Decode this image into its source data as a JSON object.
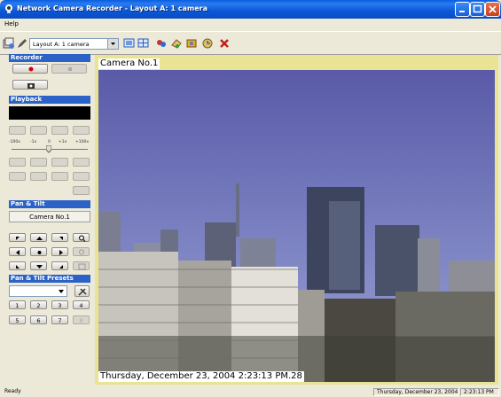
{
  "window": {
    "title": "Network Camera Recorder - Layout A: 1 camera"
  },
  "menu": {
    "help": "Help"
  },
  "toolbar": {
    "layout_select": "Layout A: 1 camera"
  },
  "sections": {
    "recorder": "Recorder",
    "playback": "Playback",
    "pan_tilt": "Pan & Tilt",
    "presets": "Pan & Tilt Presets"
  },
  "playback": {
    "speed_labels": [
      "-100x",
      "-1x",
      "0",
      "+1x",
      "+100x"
    ]
  },
  "pan_tilt": {
    "camera_label": "Camera No.1"
  },
  "presets": {
    "buttons": [
      "1",
      "2",
      "3",
      "4",
      "5",
      "6",
      "7",
      "8"
    ]
  },
  "video": {
    "camera_title": "Camera No.1",
    "timestamp": "Thursday, December 23, 2004 2:23:13 PM.28"
  },
  "status": {
    "ready": "Ready",
    "date": "Thursday, December 23, 2004",
    "time": "2:23:13 PM"
  },
  "colors": {
    "title_blue": "#0a5fe0",
    "section_blue": "#2b62c8",
    "record_red": "#d40000",
    "video_frame": "#e9e394"
  }
}
